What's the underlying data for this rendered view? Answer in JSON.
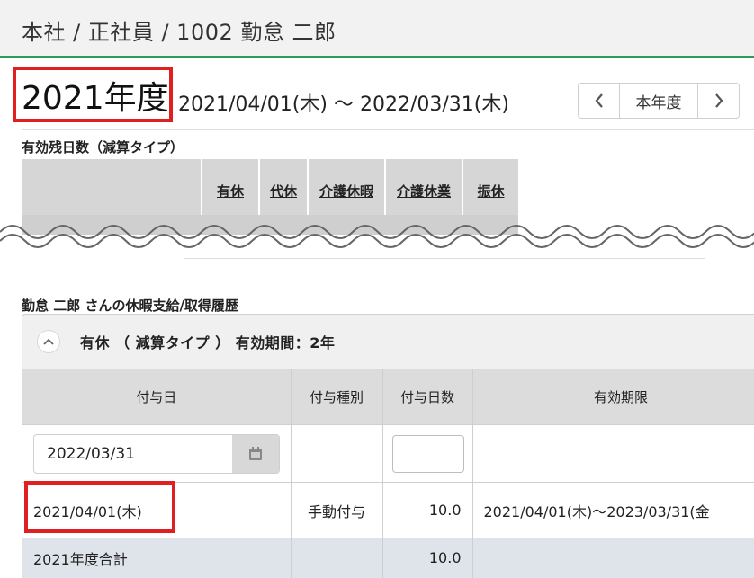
{
  "breadcrumb": "本社 / 正社員 / 1002 勤怠 二郎",
  "year": {
    "label": "2021年度",
    "period": "2021/04/01(木) ～ 2022/03/31(木)",
    "nav": {
      "current": "本年度"
    }
  },
  "balance": {
    "title": "有効残日数（減算タイプ）",
    "columns": [
      "有休",
      "代休",
      "介護休暇",
      "介護休業",
      "振休"
    ]
  },
  "history": {
    "title": "勤怠 二郎 さんの休暇支給/取得履歴",
    "panel_title": "有休 （ 減算タイプ ） 有効期間：2年",
    "headers": [
      "付与日",
      "付与種別",
      "付与日数",
      "有効期限"
    ],
    "date_input": "2022/03/31",
    "row": {
      "date": "2021/04/01(木)",
      "type": "手動付与",
      "days": "10.0",
      "expiry": "2021/04/01(木)～2023/03/31(金"
    },
    "total": {
      "label": "2021年度合計",
      "days": "10.0"
    }
  },
  "icons": {
    "prev": "chevron-left-icon",
    "next": "chevron-right-icon",
    "collapse": "chevron-up-icon",
    "calendar": "calendar-icon"
  },
  "colors": {
    "header_accent": "#2f9a5a",
    "highlight_box": "#e02020",
    "table_header": "#d6d6d6",
    "total_row": "#dfe3ea"
  }
}
